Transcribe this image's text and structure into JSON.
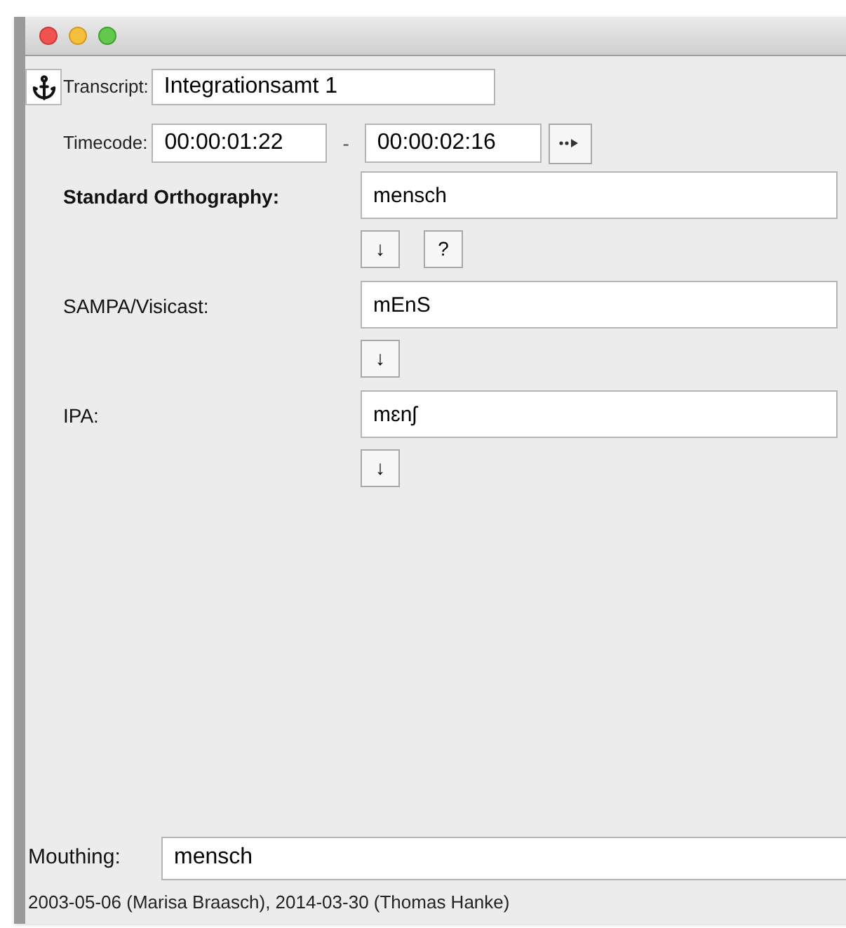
{
  "transcript": {
    "label": "Transcript:",
    "value": "Integrationsamt 1"
  },
  "timecode": {
    "label": "Timecode:",
    "start": "00:00:01:22",
    "separator": "-",
    "end": "00:00:02:16"
  },
  "fields": [
    {
      "label": "Standard Orthography:",
      "emphasized": true,
      "value": "mensch",
      "buttons": [
        "↓",
        "?"
      ]
    },
    {
      "label": "SAMPA/Visicast:",
      "emphasized": false,
      "value": "mEnS",
      "buttons": [
        "↓"
      ]
    },
    {
      "label": "IPA:",
      "emphasized": false,
      "value": "mɛnʃ",
      "buttons": [
        "↓"
      ]
    }
  ],
  "mouthing": {
    "label": "Mouthing:",
    "value": "mensch"
  },
  "status": "2003-05-06 (Marisa Braasch), 2014-03-30 (Thomas Hanke)"
}
